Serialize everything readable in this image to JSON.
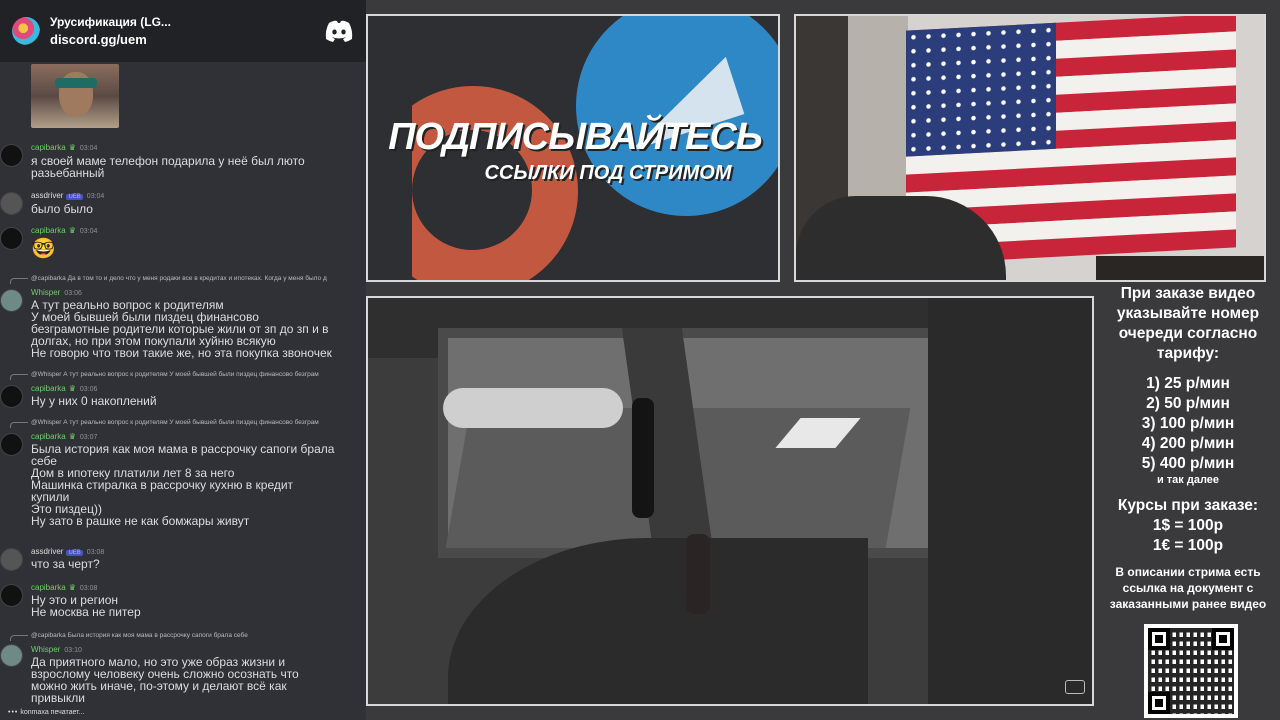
{
  "chat": {
    "server_name": "Урусификация (LG...",
    "server_invite": "discord.gg/uem",
    "icons": {
      "server": "server-icon",
      "discord": "discord-logo-icon"
    },
    "messages": [
      {
        "user": "capibarka",
        "time": "03:04",
        "text": "я своей маме телефон подарила у неё был люто\nразьебанный"
      },
      {
        "user": "assdriver",
        "badge": "UEB",
        "time": "03:04",
        "text": "было было"
      },
      {
        "user": "capibarka",
        "time": "03:04",
        "text": "🤓"
      },
      {
        "reply": "@capibarka Да в том то и дело что у меня родаки все в кредитах и ипотеках. Когда у меня было д",
        "user": "Whisper",
        "time": "03:06",
        "text": "А тут реально вопрос к родителям\nУ моей бывшей были пиздец финансово\nбезграмотные родители которые жили от зп до зп и в\nдолгах, но при этом покупали хуйню всякую\nНе говорю что твои такие же, но эта покупка звоночек"
      },
      {
        "reply": "@Whisper А тут реально вопрос к родителям У моей бывшей были пиздец финансово безграм",
        "user": "capibarka",
        "time": "03:06",
        "text": "Ну у них 0 накоплений"
      },
      {
        "reply": "@Whisper А тут реально вопрос к родителям У моей бывшей были пиздец финансово безграм",
        "user": "capibarka",
        "time": "03:07",
        "text": "Была история как моя мама в рассрочку сапоги брала\nсебе\nДом в ипотеку платили лет 8 за него\nМашинка стиралка в рассрочку кухню в кредит\nкупили\nЭто пиздец))\nНу зато в рашке не как бомжары живут"
      },
      {
        "user": "assdriver",
        "badge": "UEB",
        "time": "03:08",
        "text": "что за черт?"
      },
      {
        "user": "capibarka",
        "time": "03:08",
        "text": "Ну это и регион\nНе москва не питер"
      },
      {
        "reply": "@capibarka Была история как моя мама в рассрочку сапоги брала себе",
        "user": "Whisper",
        "time": "03:10",
        "text": "Да приятного мало, но это уже образ жизни и\nвзрослому человеку очень сложно осознать что\nможно жить иначе, по-этому и делают всё как\nпривыкли"
      }
    ],
    "typing": "konmaxa печатает..."
  },
  "promo": {
    "title": "ПОДПИСЫВАЙТЕСЬ",
    "subtitle": "ССЫЛКИ ПОД СТРИМОМ"
  },
  "info": {
    "heading": "При заказе видео указывайте номер очереди согласно тарифу:",
    "tariffs": [
      "1) 25 р/мин",
      "2) 50 р/мин",
      "3) 100 р/мин",
      "4) 200 р/мин",
      "5) 400 р/мин"
    ],
    "tariffs_more": "и так далее",
    "rates_heading": "Курсы при заказе:",
    "rates": [
      "1$ = 100р",
      "1€ = 100р"
    ],
    "description": "В описании стрима есть ссылка на документ с заказанными ранее видео"
  },
  "colors": {
    "chat_bg": "#2f3136",
    "header_bg": "#202225",
    "green_name": "#6fcf6b",
    "telegram_blue": "#2f88c6",
    "patreon_red": "#c2583f"
  }
}
